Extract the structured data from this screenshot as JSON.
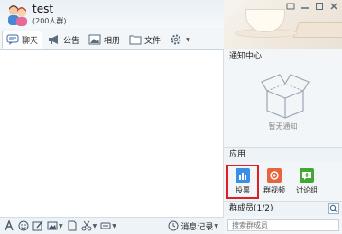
{
  "header": {
    "group_name": "test",
    "member_count": "(200人群)"
  },
  "tabs": [
    {
      "label": "聊天",
      "icon": "chat-icon"
    },
    {
      "label": "公告",
      "icon": "announcement-icon"
    },
    {
      "label": "相册",
      "icon": "album-icon"
    },
    {
      "label": "文件",
      "icon": "folder-icon"
    },
    {
      "label": "",
      "icon": "gear-icon"
    }
  ],
  "notify": {
    "title": "通知中心",
    "empty_text": "暂无通知"
  },
  "apps": {
    "title": "应用",
    "items": [
      {
        "label": "投票",
        "icon": "vote-icon",
        "color": "#3a8ee6"
      },
      {
        "label": "群视频",
        "icon": "group-video-icon",
        "color": "#e8643c"
      },
      {
        "label": "讨论组",
        "icon": "discussion-icon",
        "color": "#43a833"
      }
    ]
  },
  "members": {
    "title": "群成员(1/2)",
    "search_placeholder": "搜索群成员"
  },
  "toolbar": {
    "history_label": "消息记录"
  }
}
